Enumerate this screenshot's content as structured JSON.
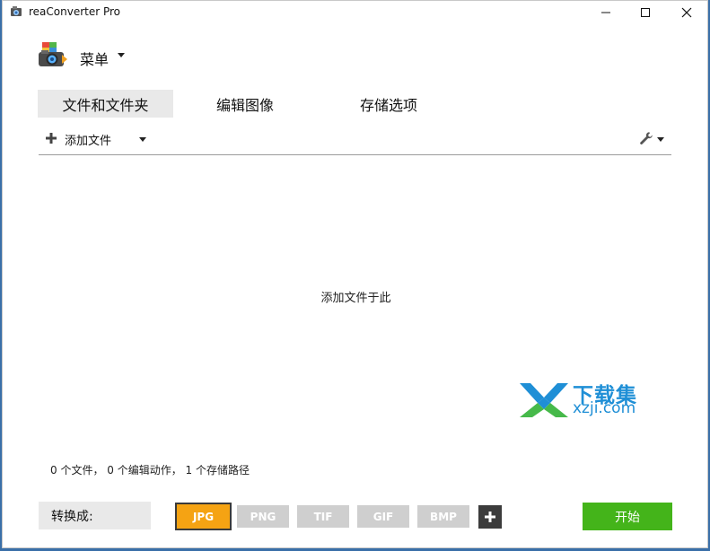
{
  "window": {
    "title": "reaConverter Pro"
  },
  "menu": {
    "label": "菜单"
  },
  "tabs": [
    {
      "label": "文件和文件夹",
      "active": true
    },
    {
      "label": "编辑图像"
    },
    {
      "label": "存储选项"
    }
  ],
  "toolbar": {
    "add_files_label": "添加文件"
  },
  "dropzone": {
    "hint": "添加文件于此"
  },
  "status": {
    "text": "0 个文件， 0 个编辑动作， 1 个存储路径"
  },
  "convert": {
    "label": "转换成:",
    "formats": [
      "JPG",
      "PNG",
      "TIF",
      "GIF",
      "BMP"
    ],
    "selected": "JPG"
  },
  "start_button": {
    "label": "开始"
  },
  "watermark": {
    "cn": "下载集",
    "en": "xzji.com"
  },
  "colors": {
    "selected_format": "#f5a313",
    "format_default": "#cfcfcf",
    "start": "#44b41a",
    "watermark": "#1f8fd6"
  },
  "icons": [
    "app-icon",
    "minimize-icon",
    "maximize-icon",
    "close-icon",
    "menu-logo-icon",
    "plus-icon",
    "chevron-down-icon",
    "wrench-icon",
    "watermark-logo-icon"
  ]
}
